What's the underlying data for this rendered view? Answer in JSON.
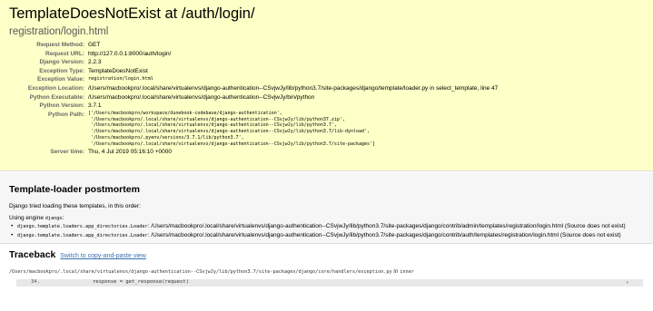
{
  "summary": {
    "title": "TemplateDoesNotExist at /auth/login/",
    "subtitle": "registration/login.html",
    "rows": [
      {
        "label": "Request Method:",
        "value": "GET"
      },
      {
        "label": "Request URL:",
        "value": "http://127.0.0.1:8000/auth/login/"
      },
      {
        "label": "Django Version:",
        "value": "2.2.3"
      },
      {
        "label": "Exception Type:",
        "value": "TemplateDoesNotExist"
      },
      {
        "label": "Exception Value:",
        "value": "registration/login.html"
      },
      {
        "label": "Exception Location:",
        "value": "/Users/macbookpro/.local/share/virtualenvs/django-authentication--CSvjwJy/lib/python3.7/site-packages/django/template/loader.py in select_template, line 47"
      },
      {
        "label": "Python Executable:",
        "value": "/Users/macbookpro/.local/share/virtualenvs/django-authentication--CSvjwJy/bin/python"
      },
      {
        "label": "Python Version:",
        "value": "3.7.1"
      },
      {
        "label": "Python Path:",
        "lines": [
          "['/Users/macbookpro/workspace/dunebook-codebase/django-authentication',",
          " '/Users/macbookpro/.local/share/virtualenvs/django-authentication--CSvjwJy/lib/python37.zip',",
          " '/Users/macbookpro/.local/share/virtualenvs/django-authentication--CSvjwJy/lib/python3.7',",
          " '/Users/macbookpro/.local/share/virtualenvs/django-authentication--CSvjwJy/lib/python3.7/lib-dynload',",
          " '/Users/macbookpro/.pyenv/versions/3.7.1/lib/python3.7',",
          " '/Users/macbookpro/.local/share/virtualenvs/django-authentication--CSvjwJy/lib/python3.7/site-packages']"
        ]
      },
      {
        "label": "Server time:",
        "value": "Thu, 4 Jul 2019 05:16:10 +0000"
      }
    ]
  },
  "postmortem": {
    "heading": "Template-loader postmortem",
    "intro": "Django tried loading these templates, in this order:",
    "engine_prefix": "Using engine ",
    "engine_name": "django",
    "engine_suffix": ":",
    "items": [
      {
        "loader": "django.template.loaders.app_directories.Loader",
        "text": ": /Users/macbookpro/.local/share/virtualenvs/django-authentication--CSvjwJy/lib/python3.7/site-packages/django/contrib/admin/templates/registration/login.html (Source does not exist)"
      },
      {
        "loader": "django.template.loaders.app_directories.Loader",
        "text": ": /Users/macbookpro/.local/share/virtualenvs/django-authentication--CSvjwJy/lib/python3.7/site-packages/django/contrib/auth/templates/registration/login.html (Source does not exist)"
      }
    ]
  },
  "traceback": {
    "heading": "Traceback",
    "switch_link": "Switch to copy-and-paste view",
    "frame_file": "/Users/macbookpro/.local/share/virtualenvs/django-authentication--CSvjwJy/lib/python3.7/site-packages/django/core/handlers/exception.py",
    "frame_in": " in ",
    "frame_func": "inner",
    "context_lineno": "34.",
    "context_code": "response = get_response(request)",
    "expand_icon": "expand-icon"
  }
}
